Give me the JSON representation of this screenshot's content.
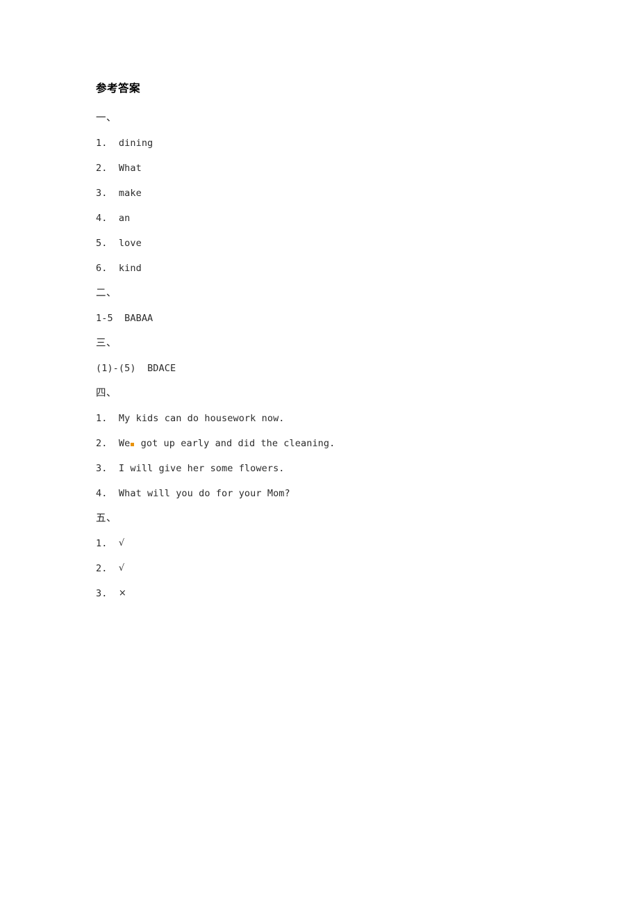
{
  "document": {
    "title": "参考答案"
  },
  "sections": [
    {
      "heading": "一、",
      "items": [
        {
          "num": "1.",
          "text": "dining"
        },
        {
          "num": "2.",
          "text": "What"
        },
        {
          "num": "3.",
          "text": "make"
        },
        {
          "num": "4.",
          "text": "an"
        },
        {
          "num": "5.",
          "text": "love"
        },
        {
          "num": "6.",
          "text": "kind"
        }
      ]
    },
    {
      "heading": "二、",
      "items": [
        {
          "num": "1-5",
          "text": "BABAA"
        }
      ]
    },
    {
      "heading": "三、",
      "items": [
        {
          "num": "(1)-(5)",
          "text": "BDACE"
        }
      ]
    },
    {
      "heading": "四、",
      "items": [
        {
          "num": "1.",
          "text": "My kids can do housework now."
        },
        {
          "num": "2.",
          "text": "We",
          "text_after": " got up early and did the cleaning.",
          "proof_mark": true
        },
        {
          "num": "3.",
          "text": "I will give her some flowers."
        },
        {
          "num": "4.",
          "text": "What will you do for your Mom?"
        }
      ]
    },
    {
      "heading": "五、",
      "items": [
        {
          "num": "1.",
          "text": "√"
        },
        {
          "num": "2.",
          "text": "√"
        },
        {
          "num": "3.",
          "text": "×"
        }
      ]
    }
  ],
  "colors": {
    "page_background": "#ffffff",
    "body_text": "#2b2b2b",
    "title_text": "#000000",
    "proof_mark": "#e8920c"
  }
}
